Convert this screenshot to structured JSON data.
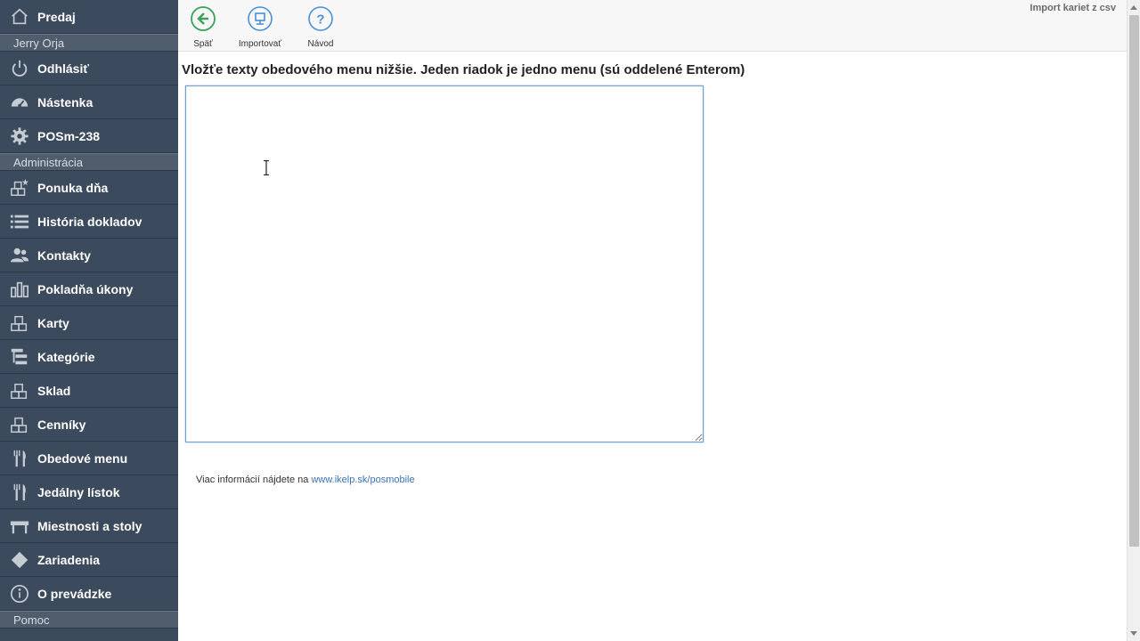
{
  "sidebar": {
    "top_item": {
      "label": "Predaj",
      "icon": "home-icon"
    },
    "user_name": "Jerry Orja",
    "user_items": [
      {
        "label": "Odhlásiť",
        "icon": "power-icon"
      },
      {
        "label": "Nástenka",
        "icon": "dashboard-icon"
      },
      {
        "label": "POSm-238",
        "icon": "gear-icon"
      }
    ],
    "admin_section": "Administrácia",
    "admin_items": [
      {
        "label": "Ponuka dňa",
        "icon": "boxes-star-icon"
      },
      {
        "label": "História dokladov",
        "icon": "list-icon"
      },
      {
        "label": "Kontakty",
        "icon": "users-icon"
      },
      {
        "label": "Pokladňa úkony",
        "icon": "bar-chart-icon"
      },
      {
        "label": "Karty",
        "icon": "boxes-icon"
      },
      {
        "label": "Kategórie",
        "icon": "tree-icon"
      },
      {
        "label": "Sklad",
        "icon": "boxes-icon"
      },
      {
        "label": "Cenníky",
        "icon": "boxes-icon"
      },
      {
        "label": "Obedové menu",
        "icon": "cutlery-icon"
      },
      {
        "label": "Jedálny lístok",
        "icon": "cutlery-icon"
      },
      {
        "label": "Miestnosti a stoly",
        "icon": "table-icon"
      },
      {
        "label": "Zariadenia",
        "icon": "diamond-icon"
      },
      {
        "label": "O prevádzke",
        "icon": "info-icon"
      }
    ],
    "help_section": "Pomoc"
  },
  "toolbar": {
    "back_label": "Späť",
    "import_label": "Importovať",
    "guide_label": "Návod",
    "page_title": "Import kariet z csv"
  },
  "main": {
    "instruction": "Vložťe texty obedového menu nižšie. Jeden riadok je jedno menu (sú oddelené Enterom)",
    "textarea_value": "",
    "footer_text": "Viac informácií nájdete na",
    "footer_link": "www.ikelp.sk/posmobile"
  },
  "colors": {
    "sidebar_bg": "#3b4a5c",
    "accent_green": "#3aa35a",
    "accent_blue": "#4a90d9",
    "link": "#3b73b9"
  }
}
